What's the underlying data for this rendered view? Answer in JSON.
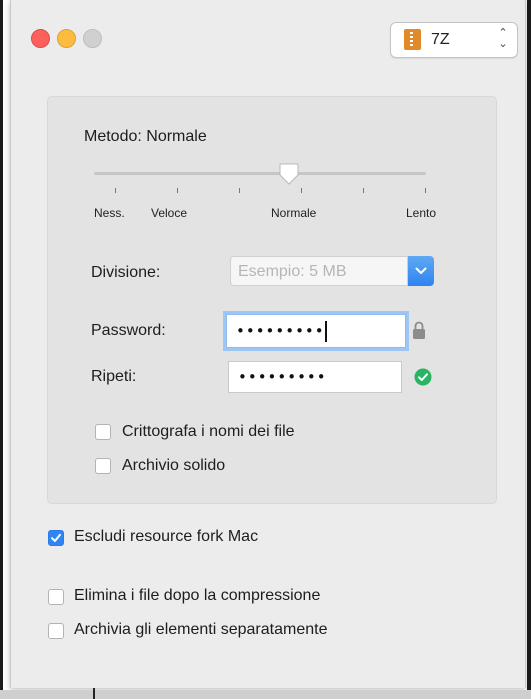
{
  "titlebar": {
    "format_select": {
      "value": "7Z"
    }
  },
  "compression": {
    "method_label": "Metodo: Normale",
    "level_value": "Normale",
    "tick_labels": [
      "Ness.",
      "Veloce",
      "Normale",
      "Lento"
    ]
  },
  "split": {
    "label": "Divisione:",
    "placeholder": "Esempio: 5 MB"
  },
  "password": {
    "label": "Password:",
    "masked_value": "•••••••••",
    "repeat_label": "Ripeti:",
    "repeat_masked_value": "•••••••••"
  },
  "options": {
    "encrypt_names": {
      "label": "Crittografa i nomi dei file",
      "checked": false
    },
    "solid_archive": {
      "label": "Archivio solido",
      "checked": false
    },
    "exclude_mac_fork": {
      "label": "Escludi resource fork Mac",
      "checked": true
    },
    "delete_after": {
      "label": "Elimina i file dopo la compressione",
      "checked": false
    },
    "archive_separately": {
      "label": "Archivia gli elementi separatamente",
      "checked": false
    }
  },
  "colors": {
    "accent": "#2f86f2",
    "close": "#fc605c",
    "minimize": "#fdbc40",
    "valid": "#28b463"
  }
}
